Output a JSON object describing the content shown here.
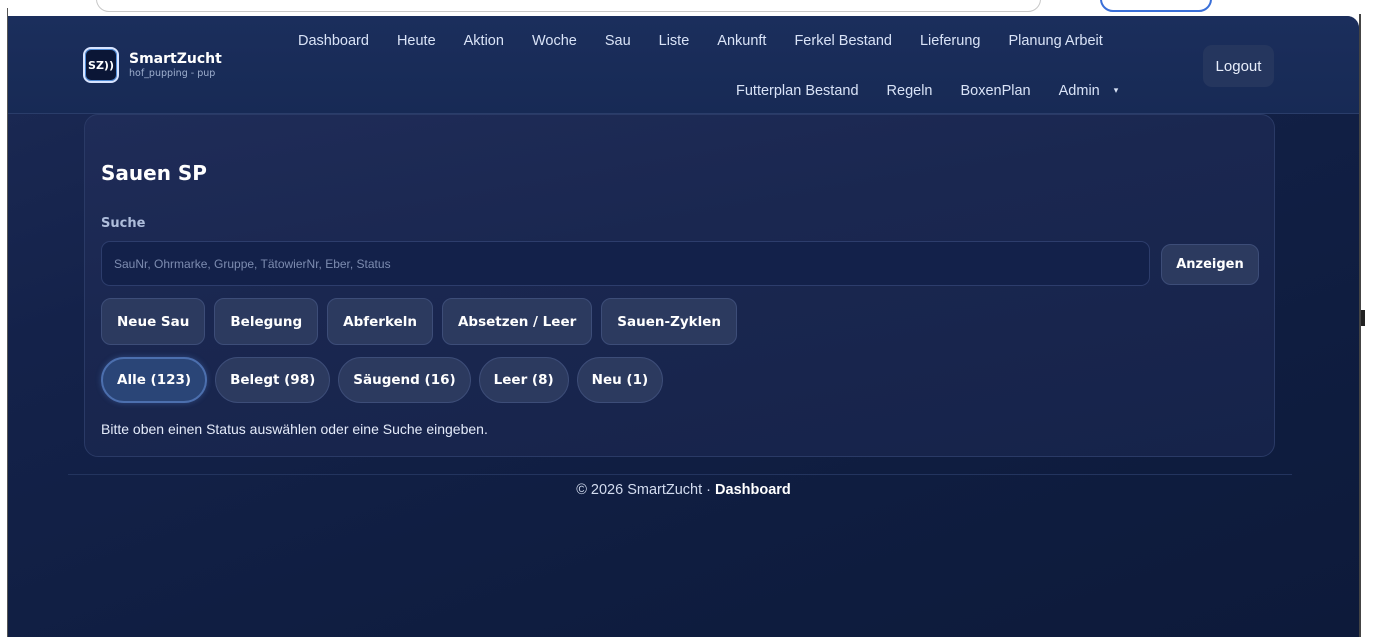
{
  "brand": {
    "logo_text": "SZ))",
    "name": "SmartZucht",
    "subtitle": "hof_pupping - pup"
  },
  "nav": {
    "row1": [
      "Dashboard",
      "Heute",
      "Aktion",
      "Woche",
      "Sau",
      "Liste",
      "Ankunft",
      "Ferkel Bestand",
      "Lieferung",
      "Planung Arbeit"
    ],
    "row2": [
      "Futterplan Bestand",
      "Regeln",
      "BoxenPlan",
      "Admin"
    ],
    "admin_caret": "▾"
  },
  "logout_label": "Logout",
  "page": {
    "title": "Sauen SP",
    "search_label": "Suche",
    "search_placeholder": "SauNr, Ohrmarke, Gruppe, TätowierNr, Eber, Status",
    "search_value": "",
    "show_button": "Anzeigen"
  },
  "actions": [
    "Neue Sau",
    "Belegung",
    "Abferkeln",
    "Absetzen / Leer",
    "Sauen-Zyklen"
  ],
  "filters": [
    {
      "label": "Alle (123)",
      "active": true
    },
    {
      "label": "Belegt (98)",
      "active": false
    },
    {
      "label": "Säugend (16)",
      "active": false
    },
    {
      "label": "Leer (8)",
      "active": false
    },
    {
      "label": "Neu (1)",
      "active": false
    }
  ],
  "hint": "Bitte oben einen Status auswählen oder eine Suche eingeben.",
  "footer": {
    "copyright": "© 2026 SmartZucht · ",
    "link": "Dashboard"
  },
  "colors": {
    "background": "#0f1d40",
    "navbar": "#1b2e5c",
    "button": "#2c3a5f",
    "active_pill": "#2a4577"
  }
}
